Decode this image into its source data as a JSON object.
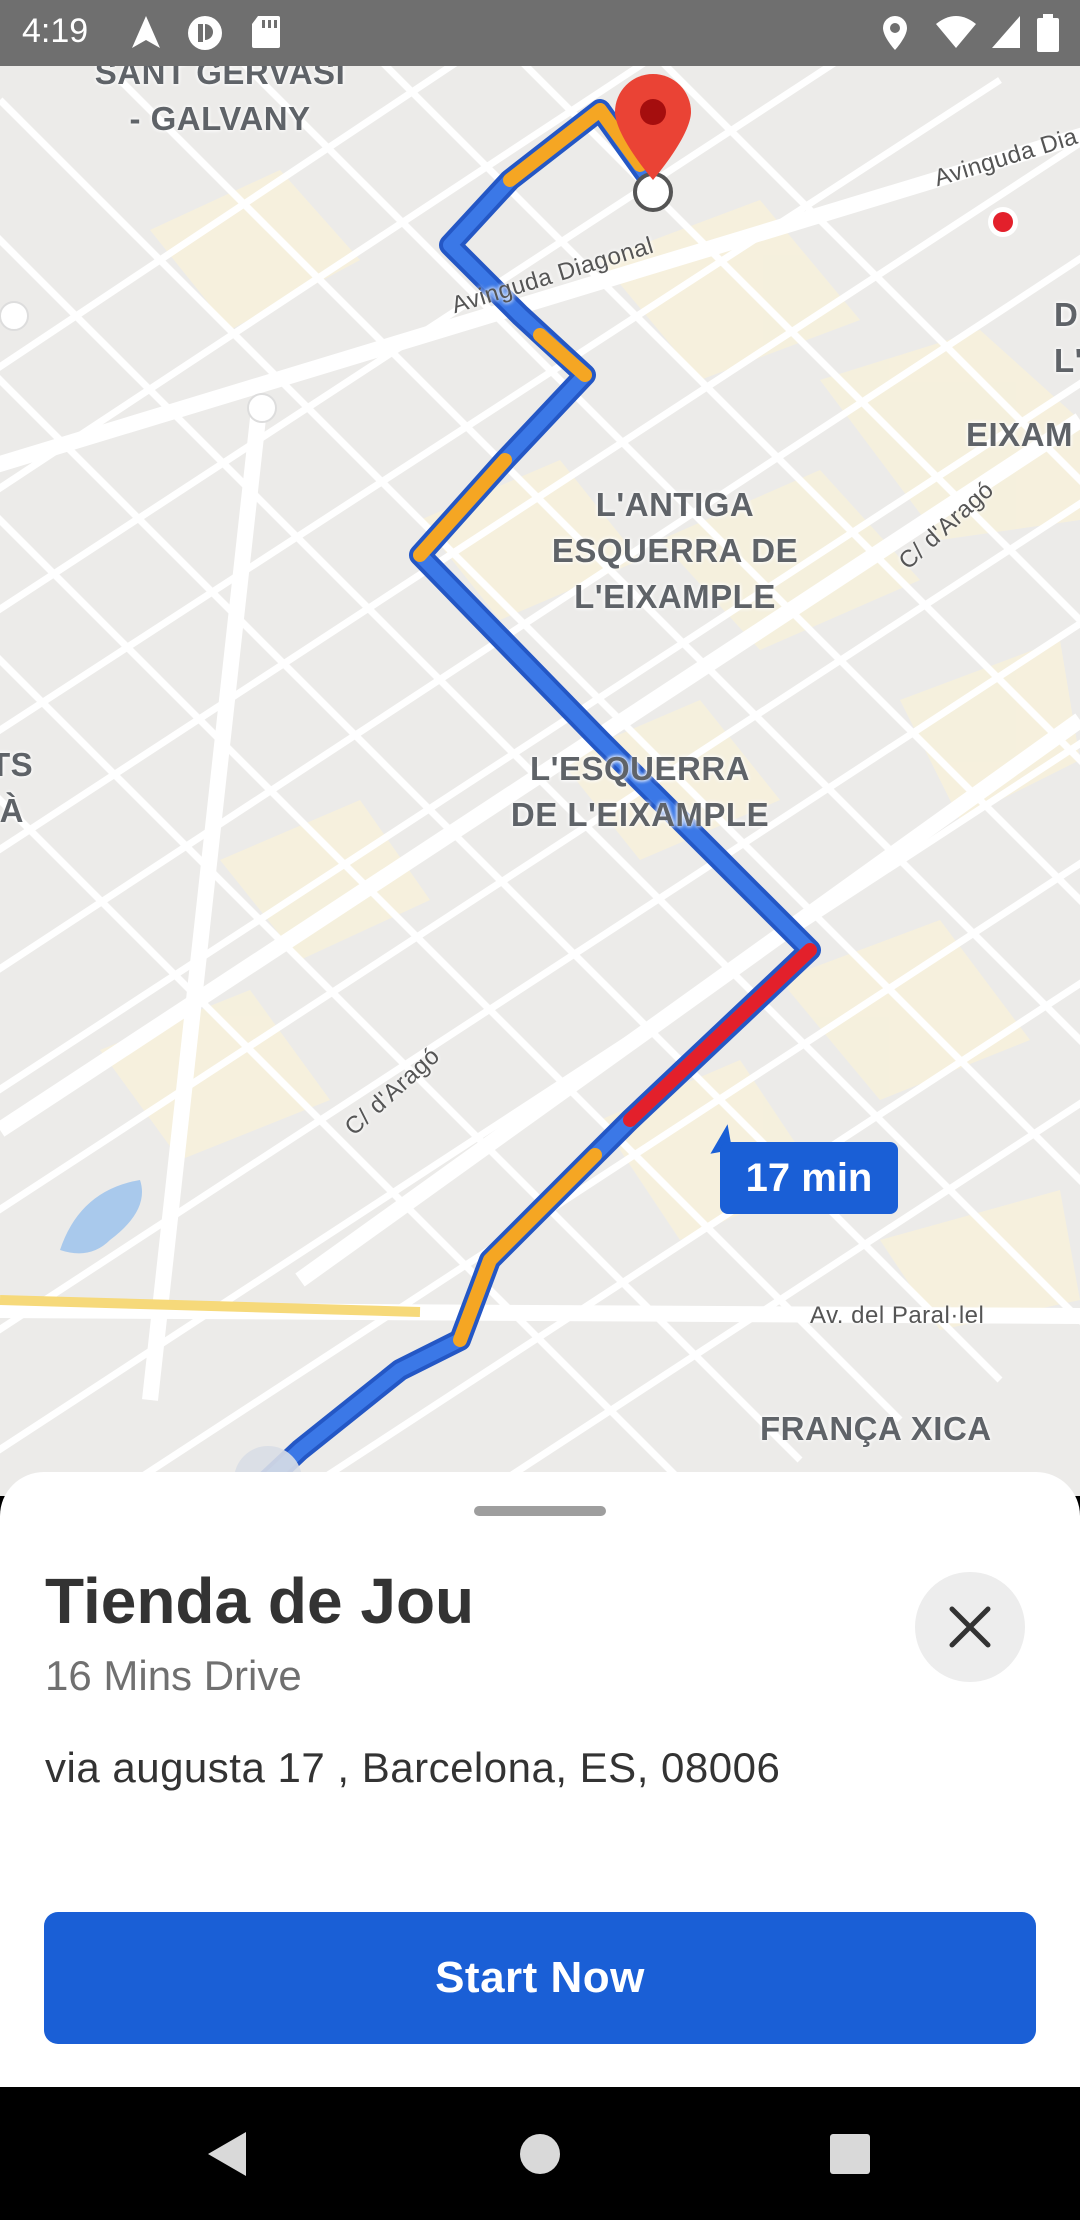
{
  "status_bar": {
    "time": "4:19",
    "icons": [
      "navigation-arrow-icon",
      "app-notification-icon",
      "sd-card-icon",
      "location-pin-icon",
      "wifi-icon",
      "signal-icon",
      "battery-icon"
    ]
  },
  "map": {
    "districts": [
      {
        "key": "sant_gervasi",
        "text": "SANT GERVASI\n- GALVANY"
      },
      {
        "key": "antiga_esquerra",
        "text": "L'ANTIGA\nESQUERRA DE\nL'EIXAMPLE"
      },
      {
        "key": "esquerra",
        "text": "L'ESQUERRA\nDE L'EIXAMPLE"
      },
      {
        "key": "eixample",
        "text": "EIXAM"
      },
      {
        "key": "left_edge",
        "text": "TS\nIÀ"
      },
      {
        "key": "right_edge",
        "text": "D\nL'"
      },
      {
        "key": "franca",
        "text": "FRANÇA XICA"
      }
    ],
    "streets": {
      "diagonal_1": "Avinguda Diagonal",
      "diagonal_2": "Avinguda Dia",
      "arago_1": "C/ d'Aragó",
      "arago_2": "C/ d'Aragó",
      "parallel": "Av. del Paral·lel"
    },
    "eta_label": "17 min",
    "route_colors": {
      "normal": "#3b78e7",
      "slow": "#f5a623",
      "heavy": "#e3202b"
    },
    "destination_marker_color": "#ea4335"
  },
  "sheet": {
    "place_name": "Tienda de Jou",
    "drive_time": "16 Mins Drive",
    "address": "via augusta 17 , Barcelona, ES, 08006",
    "close_icon": "close-icon",
    "start_label": "Start Now",
    "accent_color": "#1a5fd6"
  },
  "nav_bar": {
    "buttons": [
      "back-icon",
      "home-icon",
      "recents-icon"
    ]
  }
}
